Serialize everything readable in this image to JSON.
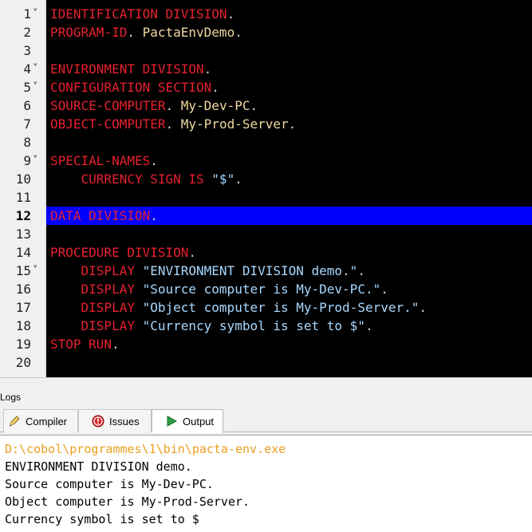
{
  "editor": {
    "active_line": "12",
    "lines": [
      {
        "num": "1",
        "fold": true,
        "parts": [
          [
            "kw",
            "IDENTIFICATION DIVISION"
          ],
          [
            "dot",
            "."
          ]
        ]
      },
      {
        "num": "2",
        "fold": false,
        "parts": [
          [
            "kw",
            "PROGRAM-ID"
          ],
          [
            "dot",
            "."
          ],
          [
            "id",
            " PactaEnvDemo"
          ],
          [
            "dot",
            "."
          ]
        ]
      },
      {
        "num": "3",
        "fold": false,
        "parts": []
      },
      {
        "num": "4",
        "fold": true,
        "parts": [
          [
            "kw",
            "ENVIRONMENT DIVISION"
          ],
          [
            "dot",
            "."
          ]
        ]
      },
      {
        "num": "5",
        "fold": true,
        "parts": [
          [
            "kw",
            "CONFIGURATION SECTION"
          ],
          [
            "dot",
            "."
          ]
        ]
      },
      {
        "num": "6",
        "fold": false,
        "parts": [
          [
            "kw",
            "SOURCE-COMPUTER"
          ],
          [
            "dot",
            "."
          ],
          [
            "id",
            " My-Dev-PC"
          ],
          [
            "dot",
            "."
          ]
        ]
      },
      {
        "num": "7",
        "fold": false,
        "parts": [
          [
            "kw",
            "OBJECT-COMPUTER"
          ],
          [
            "dot",
            "."
          ],
          [
            "id",
            " My-Prod-Server"
          ],
          [
            "dot",
            "."
          ]
        ]
      },
      {
        "num": "8",
        "fold": false,
        "parts": []
      },
      {
        "num": "9",
        "fold": true,
        "parts": [
          [
            "kw",
            "SPECIAL-NAMES"
          ],
          [
            "dot",
            "."
          ]
        ]
      },
      {
        "num": "10",
        "fold": false,
        "parts": [
          [
            "kw",
            "    CURRENCY SIGN IS "
          ],
          [
            "str",
            "\"$\""
          ],
          [
            "dot",
            "."
          ]
        ]
      },
      {
        "num": "11",
        "fold": false,
        "parts": []
      },
      {
        "num": "12",
        "fold": false,
        "highlight": true,
        "parts": [
          [
            "kw",
            "DATA DIVISION"
          ],
          [
            "dot",
            "."
          ]
        ]
      },
      {
        "num": "13",
        "fold": false,
        "parts": []
      },
      {
        "num": "14",
        "fold": false,
        "parts": [
          [
            "kw",
            "PROCEDURE DIVISION"
          ],
          [
            "dot",
            "."
          ]
        ]
      },
      {
        "num": "15",
        "fold": true,
        "parts": [
          [
            "kw",
            "    DISPLAY "
          ],
          [
            "str",
            "\"ENVIRONMENT DIVISION demo.\""
          ],
          [
            "dot",
            "."
          ]
        ]
      },
      {
        "num": "16",
        "fold": false,
        "parts": [
          [
            "kw",
            "    DISPLAY "
          ],
          [
            "str",
            "\"Source computer is My-Dev-PC.\""
          ],
          [
            "dot",
            "."
          ]
        ]
      },
      {
        "num": "17",
        "fold": false,
        "parts": [
          [
            "kw",
            "    DISPLAY "
          ],
          [
            "str",
            "\"Object computer is My-Prod-Server.\""
          ],
          [
            "dot",
            "."
          ]
        ]
      },
      {
        "num": "18",
        "fold": false,
        "parts": [
          [
            "kw",
            "    DISPLAY "
          ],
          [
            "str",
            "\"Currency symbol is set to $\""
          ],
          [
            "dot",
            "."
          ]
        ]
      },
      {
        "num": "19",
        "fold": false,
        "parts": [
          [
            "kw",
            "STOP RUN"
          ],
          [
            "dot",
            "."
          ]
        ]
      },
      {
        "num": "20",
        "fold": false,
        "parts": []
      }
    ]
  },
  "logs": {
    "label": "Logs",
    "tabs": {
      "compiler": "Compiler",
      "issues": "Issues",
      "output": "Output"
    },
    "active_tab": "Output",
    "output_lines": [
      "D:\\cobol\\programmes\\1\\bin\\pacta-env.exe",
      "ENVIRONMENT DIVISION demo.",
      "Source computer is My-Dev-PC.",
      "Object computer is My-Prod-Server.",
      "Currency symbol is set to $"
    ]
  },
  "colors": {
    "keyword": "#e8212e",
    "string": "#a8d8ff",
    "identifier": "#f0d8a0",
    "highlight": "#0000ff",
    "path": "#e8a020"
  },
  "icons": {
    "compiler": "pencil-icon",
    "issues": "error-circle-icon",
    "output": "play-icon"
  }
}
